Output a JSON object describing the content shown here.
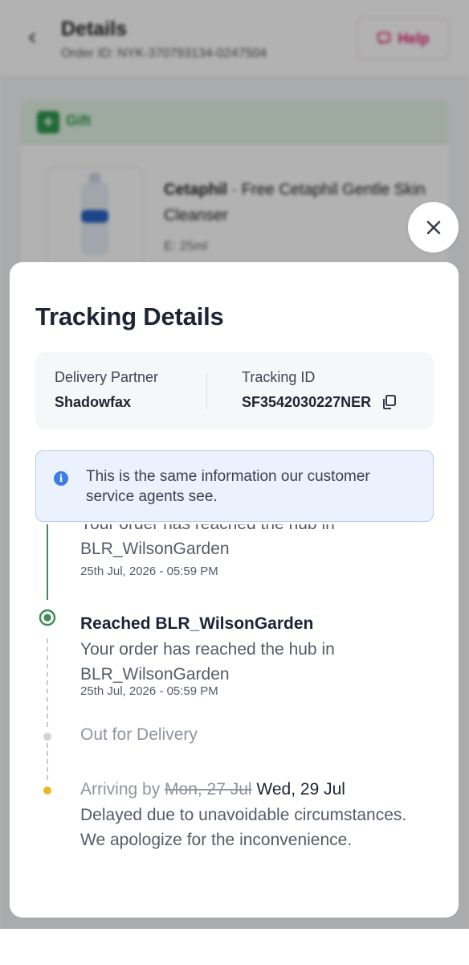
{
  "background": {
    "back_glyph": "‹",
    "title": "Details",
    "order_id": "Order ID: NYK-370793134-0247504",
    "help_label": "Help",
    "gift_label": "Gift",
    "product": {
      "brand": "Cetaphil",
      "name": " · Free Cetaphil Gentle Skin Cleanser",
      "variant": "E: 25ml"
    }
  },
  "close_glyph": "✕",
  "sheet": {
    "title": "Tracking Details",
    "delivery_partner_label": "Delivery Partner",
    "delivery_partner_value": "Shadowfax",
    "tracking_id_label": "Tracking ID",
    "tracking_id_value": "SF3542030227NER",
    "notice_glyph": "i",
    "notice_text": "This is the same information our customer service agents see."
  },
  "timeline": {
    "partial_event": {
      "description": "Your order has reached the hub in BLR_WilsonGarden",
      "time": "25th Jul, 2026 - 05:59 PM"
    },
    "current_event": {
      "title": "Reached BLR_WilsonGarden",
      "description": "Your order has reached the hub in BLR_WilsonGarden",
      "time": "25th Jul, 2026 - 05:59 PM"
    },
    "out_for_delivery": "Out for Delivery",
    "arriving": {
      "prefix": "Arriving by ",
      "old_date": "Mon, 27 Jul",
      "new_date": " Wed, 29 Jul",
      "note": "Delayed due to unavoidable circumstances. We apologize for the inconvenience."
    }
  },
  "colors": {
    "accent_green": "#3f8c55",
    "help_pink": "#e3246b",
    "notice_blue": "#3d7be6",
    "delay_yellow": "#e8b923"
  },
  "icons": {
    "close": "close-icon",
    "copy": "copy-icon",
    "info": "info-icon",
    "back": "chevron-left-icon",
    "help": "help-chat-icon",
    "gift": "gift-icon"
  }
}
